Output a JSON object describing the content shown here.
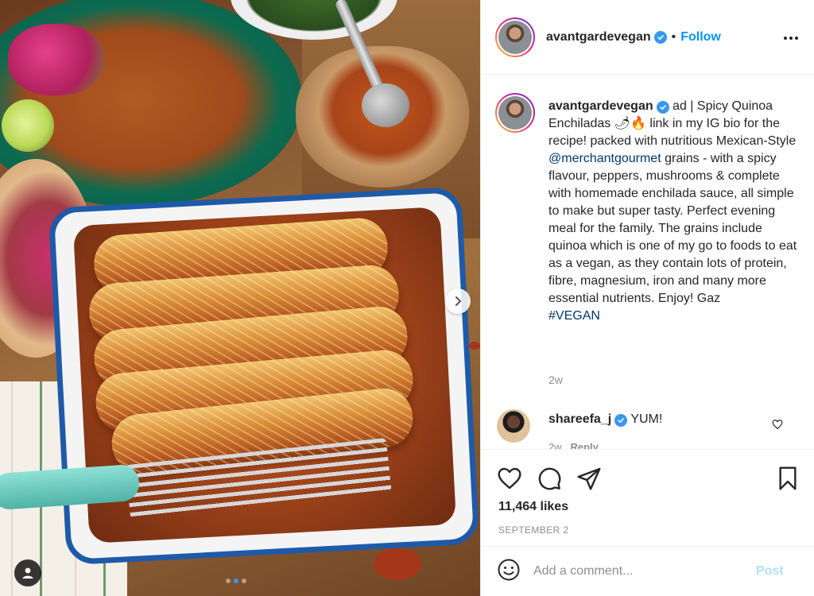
{
  "post": {
    "username": "avantgardevegan",
    "separator": "•",
    "follow_label": "Follow",
    "caption": {
      "username": "avantgardevegan",
      "text_before_mention": "ad | Spicy Quinoa Enchiladas 🌶🔥 link in my IG bio for the recipe! packed with nutritious Mexican-Style ",
      "mention": "@merchantgourmet",
      "text_after_mention": " grains - with a spicy flavour, peppers, mushrooms & complete with homemade enchilada sauce, all simple to make but super tasty. Perfect evening meal for the family. The grains include quinoa which is one of my go to foods to eat as a vegan, as they contain lots of protein, fibre, magnesium, iron and many more essential nutrients. Enjoy! Gaz",
      "hashtag": "#VEGAN"
    },
    "caption_age": "2w",
    "comment": {
      "username": "shareefa_j",
      "text": "YUM!",
      "age": "2w",
      "reply_label": "Reply"
    },
    "likes": "11,464 likes",
    "date": "SEPTEMBER 2",
    "add_comment_placeholder": "Add a comment...",
    "post_label": "Post"
  },
  "carousel": {
    "slides": 3,
    "active_index": 1
  },
  "colors": {
    "accent": "#0095f6",
    "verified": "#3897f0",
    "muted": "#8e8e8e",
    "post_disabled": "#b2dffc"
  },
  "icons": [
    "more-options-icon",
    "verified-icon",
    "heart-icon",
    "comment-icon",
    "share-icon",
    "bookmark-icon",
    "emoji-icon",
    "user-tag-icon",
    "chevron-right-icon"
  ]
}
